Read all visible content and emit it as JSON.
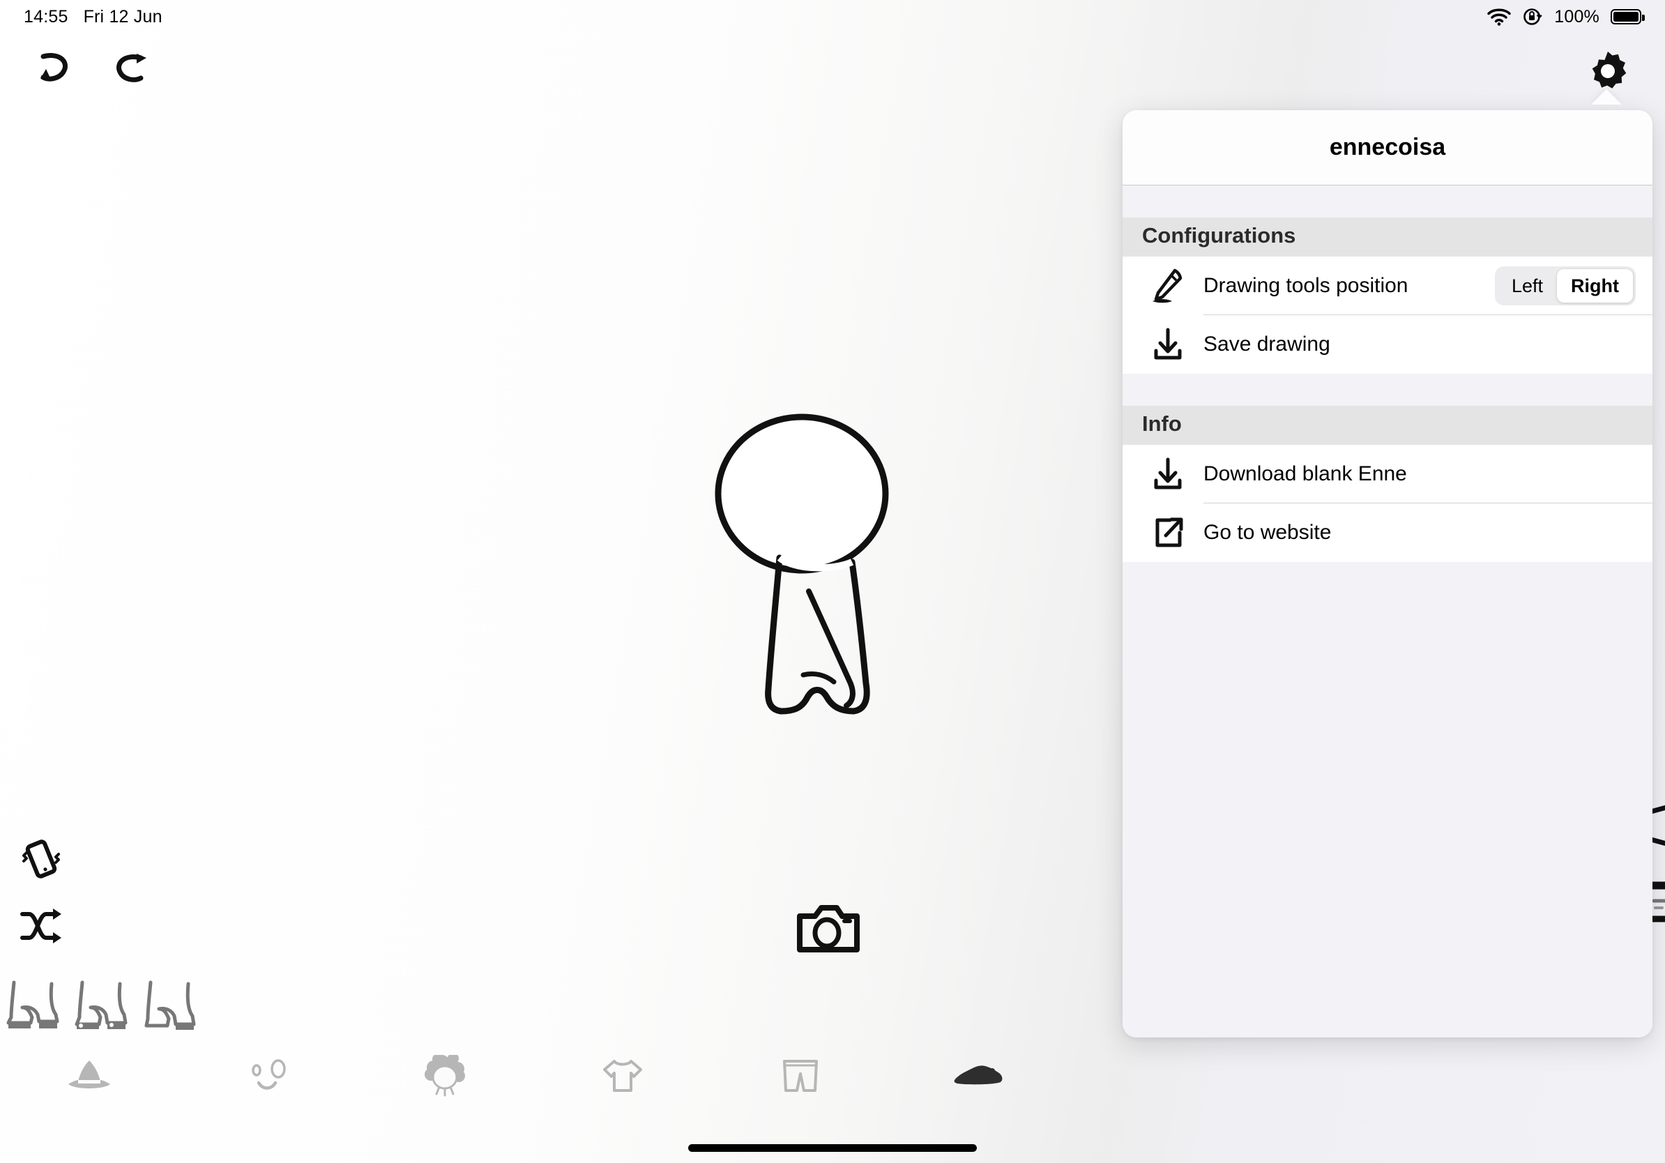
{
  "status_bar": {
    "time": "14:55",
    "date": "Fri 12 Jun",
    "battery_percent": "100%",
    "wifi_icon": "wifi-icon",
    "rotation_lock_icon": "rotation-lock-icon",
    "battery_icon": "battery-full-icon"
  },
  "toolbar": {
    "undo_icon": "undo-icon",
    "redo_icon": "redo-icon",
    "settings_icon": "gear-icon"
  },
  "canvas": {
    "character_name": "enne-character",
    "camera_label": "camera-icon"
  },
  "left_tools": [
    {
      "name": "shake-phone-icon",
      "label": "Shake"
    },
    {
      "name": "shuffle-icon",
      "label": "Shuffle"
    }
  ],
  "option_strip": [
    {
      "name": "shoes-option-1"
    },
    {
      "name": "shoes-option-2"
    },
    {
      "name": "shoes-option-3"
    }
  ],
  "right_edge_tools": [
    {
      "name": "eraser-tool-icon"
    },
    {
      "name": "marker-tool-icon"
    }
  ],
  "bottom_nav": [
    {
      "name": "nav-hat",
      "label": "Hat",
      "selected": false
    },
    {
      "name": "nav-face",
      "label": "Face",
      "selected": false
    },
    {
      "name": "nav-hair",
      "label": "Hair",
      "selected": false
    },
    {
      "name": "nav-top",
      "label": "Top",
      "selected": false
    },
    {
      "name": "nav-bottom",
      "label": "Bottom",
      "selected": false
    },
    {
      "name": "nav-shoes",
      "label": "Shoes",
      "selected": true
    }
  ],
  "popover": {
    "title": "ennecoisa",
    "sections": [
      {
        "header": "Configurations",
        "rows": [
          {
            "icon": "pencil-icon",
            "label": "Drawing tools position",
            "control": "segmented",
            "options": [
              "Left",
              "Right"
            ],
            "selected": "Right"
          },
          {
            "icon": "download-icon",
            "label": "Save drawing",
            "control": "none"
          }
        ]
      },
      {
        "header": "Info",
        "rows": [
          {
            "icon": "download-icon",
            "label": "Download blank Enne",
            "control": "none"
          },
          {
            "icon": "external-link-icon",
            "label": "Go to website",
            "control": "none"
          }
        ]
      }
    ]
  },
  "colors": {
    "panel_bg": "#f2f2f7",
    "section_header_bg": "#e4e4e4",
    "row_bg": "#ffffff",
    "segment_track": "#ececee",
    "ink": "#000000",
    "nav_inactive": "#b4b4b4",
    "nav_active": "#2e2e2e"
  }
}
